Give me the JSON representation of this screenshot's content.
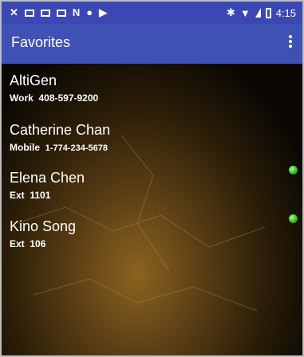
{
  "status_bar": {
    "time": "4:15",
    "icons_left": [
      "missed-call-icon",
      "gmail-icon",
      "mail-icon",
      "gmail-icon",
      "n-icon",
      "person-icon",
      "play-icon"
    ],
    "icons_right": [
      "bluetooth-icon",
      "wifi-icon",
      "signal-icon",
      "battery-icon"
    ]
  },
  "app_bar": {
    "title": "Favorites",
    "menu_icon": "overflow-menu-icon"
  },
  "favorites": [
    {
      "name": "AltiGen",
      "label": "Work",
      "number": "408-597-9200",
      "presence": false
    },
    {
      "name": "Catherine Chan",
      "label": "Mobile",
      "number": "1-774-234-5678",
      "presence": false
    },
    {
      "name": "Elena Chen",
      "label": "Ext",
      "number": "1101",
      "presence": true,
      "presence_color": "#2fb51d"
    },
    {
      "name": "Kino Song",
      "label": "Ext",
      "number": "106",
      "presence": true,
      "presence_color": "#2fb51d"
    }
  ],
  "colors": {
    "status_bar": "#3b48b3",
    "app_bar": "#3f51b5",
    "presence_online": "#2fb51d"
  }
}
